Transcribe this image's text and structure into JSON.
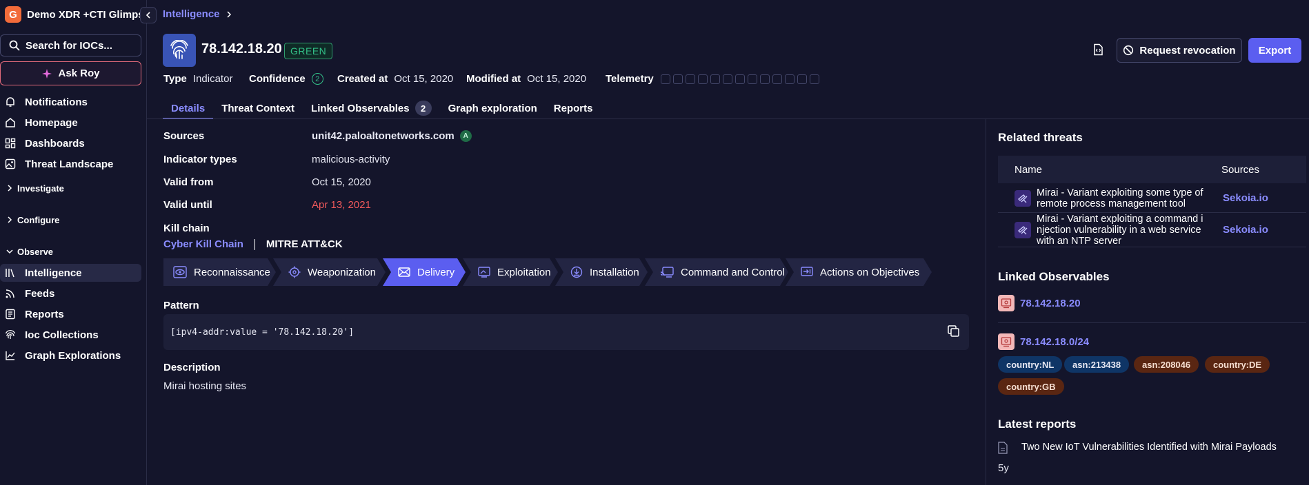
{
  "sidebar": {
    "workspace_initial": "G",
    "workspace_name": "Demo XDR +CTI Glimps",
    "search_label": "Search for IOCs...",
    "ask_label": "Ask Roy",
    "nav_top": [
      {
        "label": "Notifications",
        "icon": "bell-icon"
      },
      {
        "label": "Homepage",
        "icon": "home-icon"
      },
      {
        "label": "Dashboards",
        "icon": "dashboard-icon"
      },
      {
        "label": "Threat Landscape",
        "icon": "image-icon"
      }
    ],
    "sections": [
      "Investigate",
      "Configure",
      "Observe"
    ],
    "nav_observe": [
      {
        "label": "Intelligence",
        "icon": "library-icon",
        "active": true
      },
      {
        "label": "Feeds",
        "icon": "rss-icon"
      },
      {
        "label": "Reports",
        "icon": "reports-icon"
      },
      {
        "label": "Ioc Collections",
        "icon": "fingerprint-icon"
      },
      {
        "label": "Graph Explorations",
        "icon": "graph-icon"
      }
    ]
  },
  "header": {
    "breadcrumb": "Intelligence",
    "title": "78.142.18.20",
    "tlp": "GREEN",
    "revoke_label": "Request revocation",
    "export_label": "Export"
  },
  "meta": {
    "type_label": "Type",
    "type_value": "Indicator",
    "confidence_label": "Confidence",
    "confidence_value": "2",
    "created_label": "Created at",
    "created_value": "Oct 15, 2020",
    "modified_label": "Modified at",
    "modified_value": "Oct 15, 2020",
    "telemetry_label": "Telemetry",
    "telemetry_boxes": 13
  },
  "tabs": [
    {
      "label": "Details",
      "active": true
    },
    {
      "label": "Threat Context"
    },
    {
      "label": "Linked Observables",
      "count": "2"
    },
    {
      "label": "Graph exploration"
    },
    {
      "label": "Reports"
    }
  ],
  "details": {
    "sources_label": "Sources",
    "sources_value": "unit42.paloaltonetworks.com",
    "sources_badge": "A",
    "types_label": "Indicator types",
    "types_value": "malicious-activity",
    "valid_from_label": "Valid from",
    "valid_from_value": "Oct 15, 2020",
    "valid_until_label": "Valid until",
    "valid_until_value": "Apr 13, 2021",
    "kill_chain_label": "Kill chain",
    "kill_chain_tab_a": "Cyber Kill Chain",
    "kill_chain_tab_b": "MITRE ATT&CK",
    "phases": [
      {
        "label": "Reconnaissance",
        "icon": "eye-icon"
      },
      {
        "label": "Weaponization",
        "icon": "target-icon"
      },
      {
        "label": "Delivery",
        "icon": "mail-icon",
        "active": true
      },
      {
        "label": "Exploitation",
        "icon": "screen-icon"
      },
      {
        "label": "Installation",
        "icon": "download-icon"
      },
      {
        "label": "Command and Control",
        "icon": "cast-icon"
      },
      {
        "label": "Actions on Objectives",
        "icon": "login-icon"
      }
    ],
    "pattern_label": "Pattern",
    "pattern_value": "[ipv4-addr:value = '78.142.18.20']",
    "description_label": "Description",
    "description_value": "Mirai hosting sites"
  },
  "related": {
    "title": "Related threats",
    "col_name": "Name",
    "col_sources": "Sources",
    "rows": [
      {
        "name": "Mirai - Variant exploiting some type of remote process management tool",
        "source": "Sekoia.io"
      },
      {
        "name": "Mirai - Variant exploiting a command i njection vulnerability in a web service with an NTP server",
        "source": "Sekoia.io"
      }
    ]
  },
  "observables": {
    "title": "Linked Observables",
    "items": [
      {
        "label": "78.142.18.20"
      },
      {
        "label": "78.142.18.0/24"
      }
    ],
    "tags": [
      {
        "label": "country:NL",
        "color": "#0f3566"
      },
      {
        "label": "asn:213438",
        "color": "#0f3566"
      },
      {
        "label": "asn:208046",
        "color": "#5a2612"
      },
      {
        "label": "country:DE",
        "color": "#5a2612"
      },
      {
        "label": "country:GB",
        "color": "#5a2612"
      }
    ]
  },
  "reports": {
    "title": "Latest reports",
    "items": [
      {
        "label": "Two New IoT Vulnerabilities Identified with Mirai Payloads",
        "age": "5y"
      }
    ]
  },
  "colors": {
    "accent": "#5b5ef0",
    "link": "#8a8cff",
    "danger": "#f0595b",
    "tlp_green": "#33c088"
  }
}
